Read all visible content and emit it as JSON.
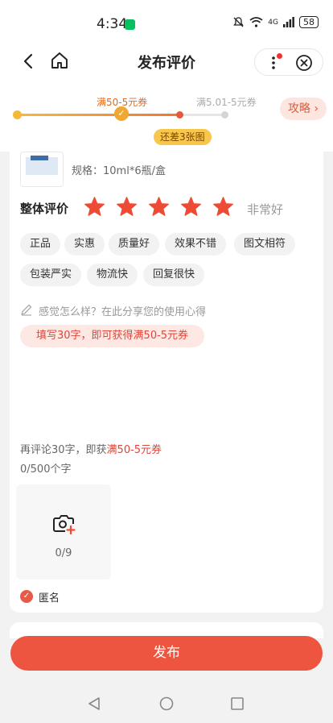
{
  "status_bar": {
    "time": "4:34",
    "network": "4G",
    "battery": "58"
  },
  "header": {
    "title": "发布评价"
  },
  "progress": {
    "milestone_1": "满50-5元券",
    "milestone_2": "满5.01-5元券",
    "tip": "还差3张图",
    "strategy_label": "攻略"
  },
  "product": {
    "spec": "规格：10ml*6瓶/盒"
  },
  "rating": {
    "label": "整体评价",
    "stars": 5,
    "text": "非常好"
  },
  "tags": [
    "正品",
    "实惠",
    "质量好",
    "效果不错",
    "图文相符",
    "包装严实",
    "物流快",
    "回复很快"
  ],
  "review": {
    "placeholder": "感觉怎么样？在此分享您的使用心得",
    "promo": "填写30字，即可获得满50-5元券",
    "hint_prefix": "再评论30字，即获",
    "hint_highlight": "满50-5元券",
    "counter": "0/500个字"
  },
  "upload": {
    "count": "0/9"
  },
  "anonymous": {
    "label": "匿名"
  },
  "publish": {
    "label": "发布"
  },
  "colors": {
    "accent": "#ee5540",
    "star": "#ee4b36",
    "progress_gold": "#f5b93a"
  }
}
